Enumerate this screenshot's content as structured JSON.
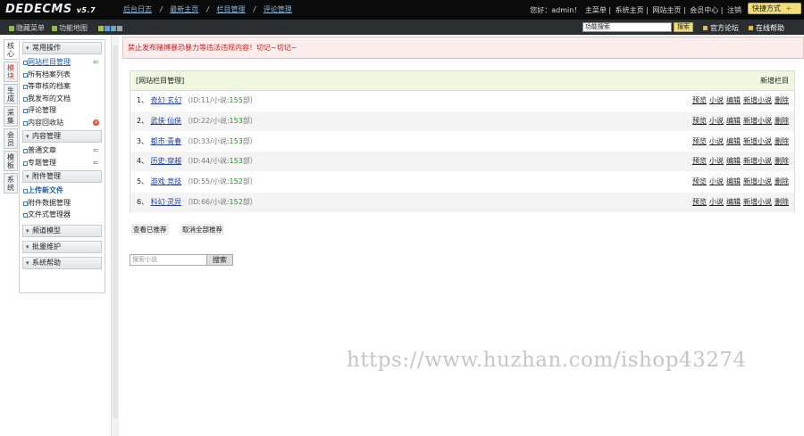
{
  "topbar": {
    "logo": "DEDECMS",
    "version": "v5.7",
    "nav": [
      "后台日志",
      "最新主页",
      "栏目管理",
      "评论管理"
    ],
    "right": [
      "您好：admin！",
      "主菜单",
      "系统主页",
      "网站主页",
      "会员中心",
      "注销"
    ],
    "quick": "快捷方式"
  },
  "bar2": {
    "hide_menu": "隐藏菜单",
    "func_map": "功能地图",
    "search_value": "功能搜索",
    "search_btn": "搜索",
    "forum": "官方论坛",
    "help": "在线帮助"
  },
  "left_tabs": [
    "核心",
    "模块",
    "生成",
    "采集",
    "会员",
    "模板",
    "系统"
  ],
  "menu": {
    "groups": [
      {
        "title": "常用操作",
        "items": [
          "网站栏目管理",
          "所有档案列表",
          "等审核的档案",
          "我发布的文档",
          "评论管理",
          "内容回收站"
        ]
      },
      {
        "title": "内容管理",
        "items": [
          "普通文章",
          "专题管理"
        ]
      },
      {
        "title": "附件管理",
        "items": [
          "上传新文件",
          "附件数据管理",
          "文件式管理器"
        ]
      },
      {
        "title": "频道模型",
        "items": []
      },
      {
        "title": "批量维护",
        "items": []
      },
      {
        "title": "系统帮助",
        "items": []
      }
    ]
  },
  "warning": "禁止发布赌博暴恐暴力等违法违规内容！切记~切记~",
  "panel": {
    "title": "[网站栏目管理]",
    "new_label": "新增栏目",
    "rows": [
      {
        "idx": "1、",
        "name": "奇幻·玄幻",
        "meta_pre": "（ID:11/小说:",
        "count": "155",
        "meta_post": "部）"
      },
      {
        "idx": "2、",
        "name": "武侠·仙侠",
        "meta_pre": "（ID:22/小说:",
        "count": "153",
        "meta_post": "部）"
      },
      {
        "idx": "3、",
        "name": "都市·青春",
        "meta_pre": "（ID:33/小说:",
        "count": "153",
        "meta_post": "部）"
      },
      {
        "idx": "4、",
        "name": "历史·穿越",
        "meta_pre": "（ID:44/小说:",
        "count": "153",
        "meta_post": "部）"
      },
      {
        "idx": "5、",
        "name": "游戏·竞技",
        "meta_pre": "（ID:55/小说:",
        "count": "152",
        "meta_post": "部）"
      },
      {
        "idx": "6、",
        "name": "科幻·灵异",
        "meta_pre": "（ID:66/小说:",
        "count": "152",
        "meta_post": "部）"
      }
    ],
    "actions": [
      "预览",
      "小说",
      "编辑",
      "新增小说",
      "删除"
    ]
  },
  "buttons": {
    "view_recommended": "查看已推荐",
    "cancel_all": "取消全部推荐"
  },
  "novel_search": {
    "placeholder": "搜索小说",
    "btn": "搜索"
  },
  "watermark": "https://www.huzhan.com/ishop43274"
}
